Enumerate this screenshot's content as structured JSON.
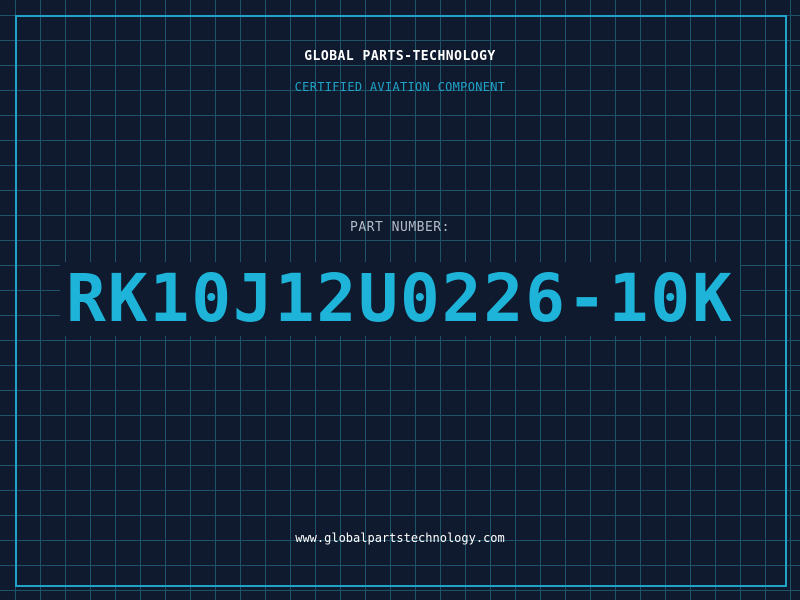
{
  "header": {
    "brand": "GLOBAL PARTS-TECHNOLOGY",
    "tagline": "CERTIFIED AVIATION COMPONENT"
  },
  "part": {
    "label": "PART NUMBER:",
    "number": "RK10J12U0226-10K"
  },
  "footer": {
    "website": "www.globalpartstechnology.com"
  },
  "colors": {
    "background": "#101a2e",
    "grid": "#1d5268",
    "accent": "#1fa3c8",
    "part_number": "#1eb4d9",
    "text": "#ffffff",
    "label": "#b3bcc8"
  }
}
